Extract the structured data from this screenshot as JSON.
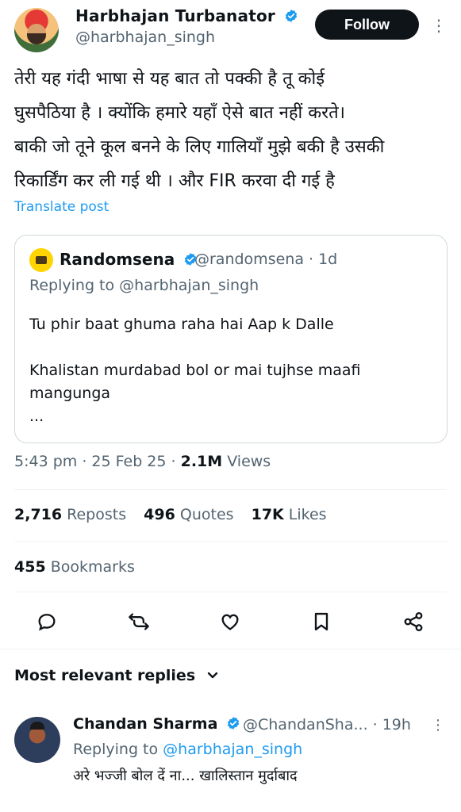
{
  "author": {
    "name": "Harbhajan Turbanator",
    "handle": "@harbhajan_singh",
    "follow_label": "Follow"
  },
  "post": {
    "lines": [
      "तेरी यह गंदी भाषा से यह बात तो पक्की है तू कोई",
      "घुसपैठिया है । क्योंकि हमारे यहाँ ऐसे बात नहीं करते।",
      "बाकी जो तूने कूल बनने के लिए गालियाँ मुझे बकी है उसकी",
      "रिकार्डिंग कर ली गई थी । और FIR करवा दी गई है"
    ],
    "translate_label": "Translate post"
  },
  "quote": {
    "name": "Randomsena",
    "handle_time": "@randomsena · 1d",
    "replying_to": "Replying to @harbhajan_singh",
    "para1": "Tu phir baat ghuma raha hai Aap k Dalle",
    "para2": "Khalistan murdabad bol or mai tujhse maafi mangunga",
    "ellipsis": "..."
  },
  "meta": {
    "time_date": "5:43 pm · 25 Feb 25 · ",
    "views_count": "2.1M",
    "views_label": " Views"
  },
  "stats": {
    "reposts_count": "2,716",
    "reposts_label": " Reposts",
    "quotes_count": "496",
    "quotes_label": " Quotes",
    "likes_count": "17K",
    "likes_label": " Likes",
    "bookmarks_count": "455",
    "bookmarks_label": " Bookmarks"
  },
  "actions": [
    "reply-icon",
    "repost-icon",
    "like-icon",
    "bookmark-icon",
    "share-icon"
  ],
  "replies": {
    "header": "Most relevant replies",
    "items": [
      {
        "name": "Chandan Sharma",
        "handle_time": "@ChandanSha... · 19h",
        "replying_prefix": "Replying to ",
        "replying_handle": "@harbhajan_singh",
        "text": "अरे भज्जी बोल दें ना... खालिस्तान मुर्दाबाद"
      }
    ]
  },
  "colors": {
    "accent": "#1d9bf0",
    "text": "#0f1419",
    "secondary": "#536471",
    "border": "#cfd9de"
  }
}
